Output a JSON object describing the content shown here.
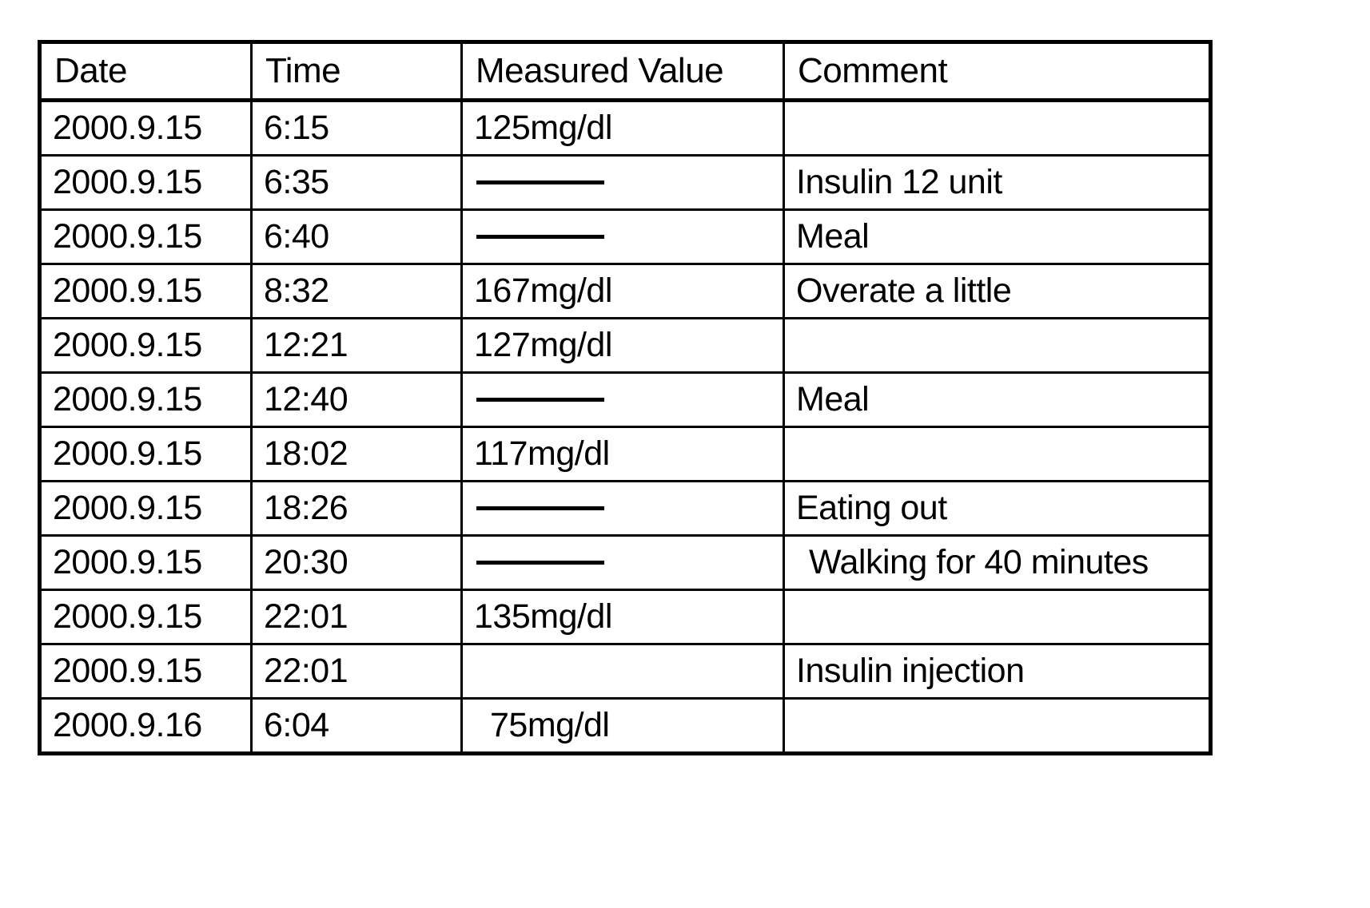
{
  "table": {
    "columns": [
      {
        "key": "date",
        "label": "Date"
      },
      {
        "key": "time",
        "label": "Time"
      },
      {
        "key": "value",
        "label": "Measured Value"
      },
      {
        "key": "comment",
        "label": "Comment"
      }
    ],
    "dash_placeholder": "———",
    "rows": [
      {
        "date": "2000.9.15",
        "time": "6:15",
        "value": "125mg/dl",
        "comment": ""
      },
      {
        "date": "2000.9.15",
        "time": "6:35",
        "value": "—",
        "comment": "Insulin 12 unit"
      },
      {
        "date": "2000.9.15",
        "time": "6:40",
        "value": "—",
        "comment": "Meal"
      },
      {
        "date": "2000.9.15",
        "time": "8:32",
        "value": "167mg/dl",
        "comment": "Overate a little"
      },
      {
        "date": "2000.9.15",
        "time": "12:21",
        "value": "127mg/dl",
        "comment": ""
      },
      {
        "date": "2000.9.15",
        "time": "12:40",
        "value": "—",
        "comment": "Meal"
      },
      {
        "date": "2000.9.15",
        "time": "18:02",
        "value": "117mg/dl",
        "comment": ""
      },
      {
        "date": "2000.9.15",
        "time": "18:26",
        "value": "—",
        "comment": "Eating out"
      },
      {
        "date": "2000.9.15",
        "time": "20:30",
        "value": "—",
        "comment": "Walking for 40 minutes"
      },
      {
        "date": "2000.9.15",
        "time": "22:01",
        "value": "135mg/dl",
        "comment": ""
      },
      {
        "date": "2000.9.15",
        "time": "22:01",
        "value": "",
        "comment": "Insulin injection"
      },
      {
        "date": "2000.9.16",
        "time": "6:04",
        "value": "75mg/dl",
        "comment": ""
      }
    ]
  },
  "colors": {
    "ink": "#000000",
    "paper": "#ffffff"
  }
}
